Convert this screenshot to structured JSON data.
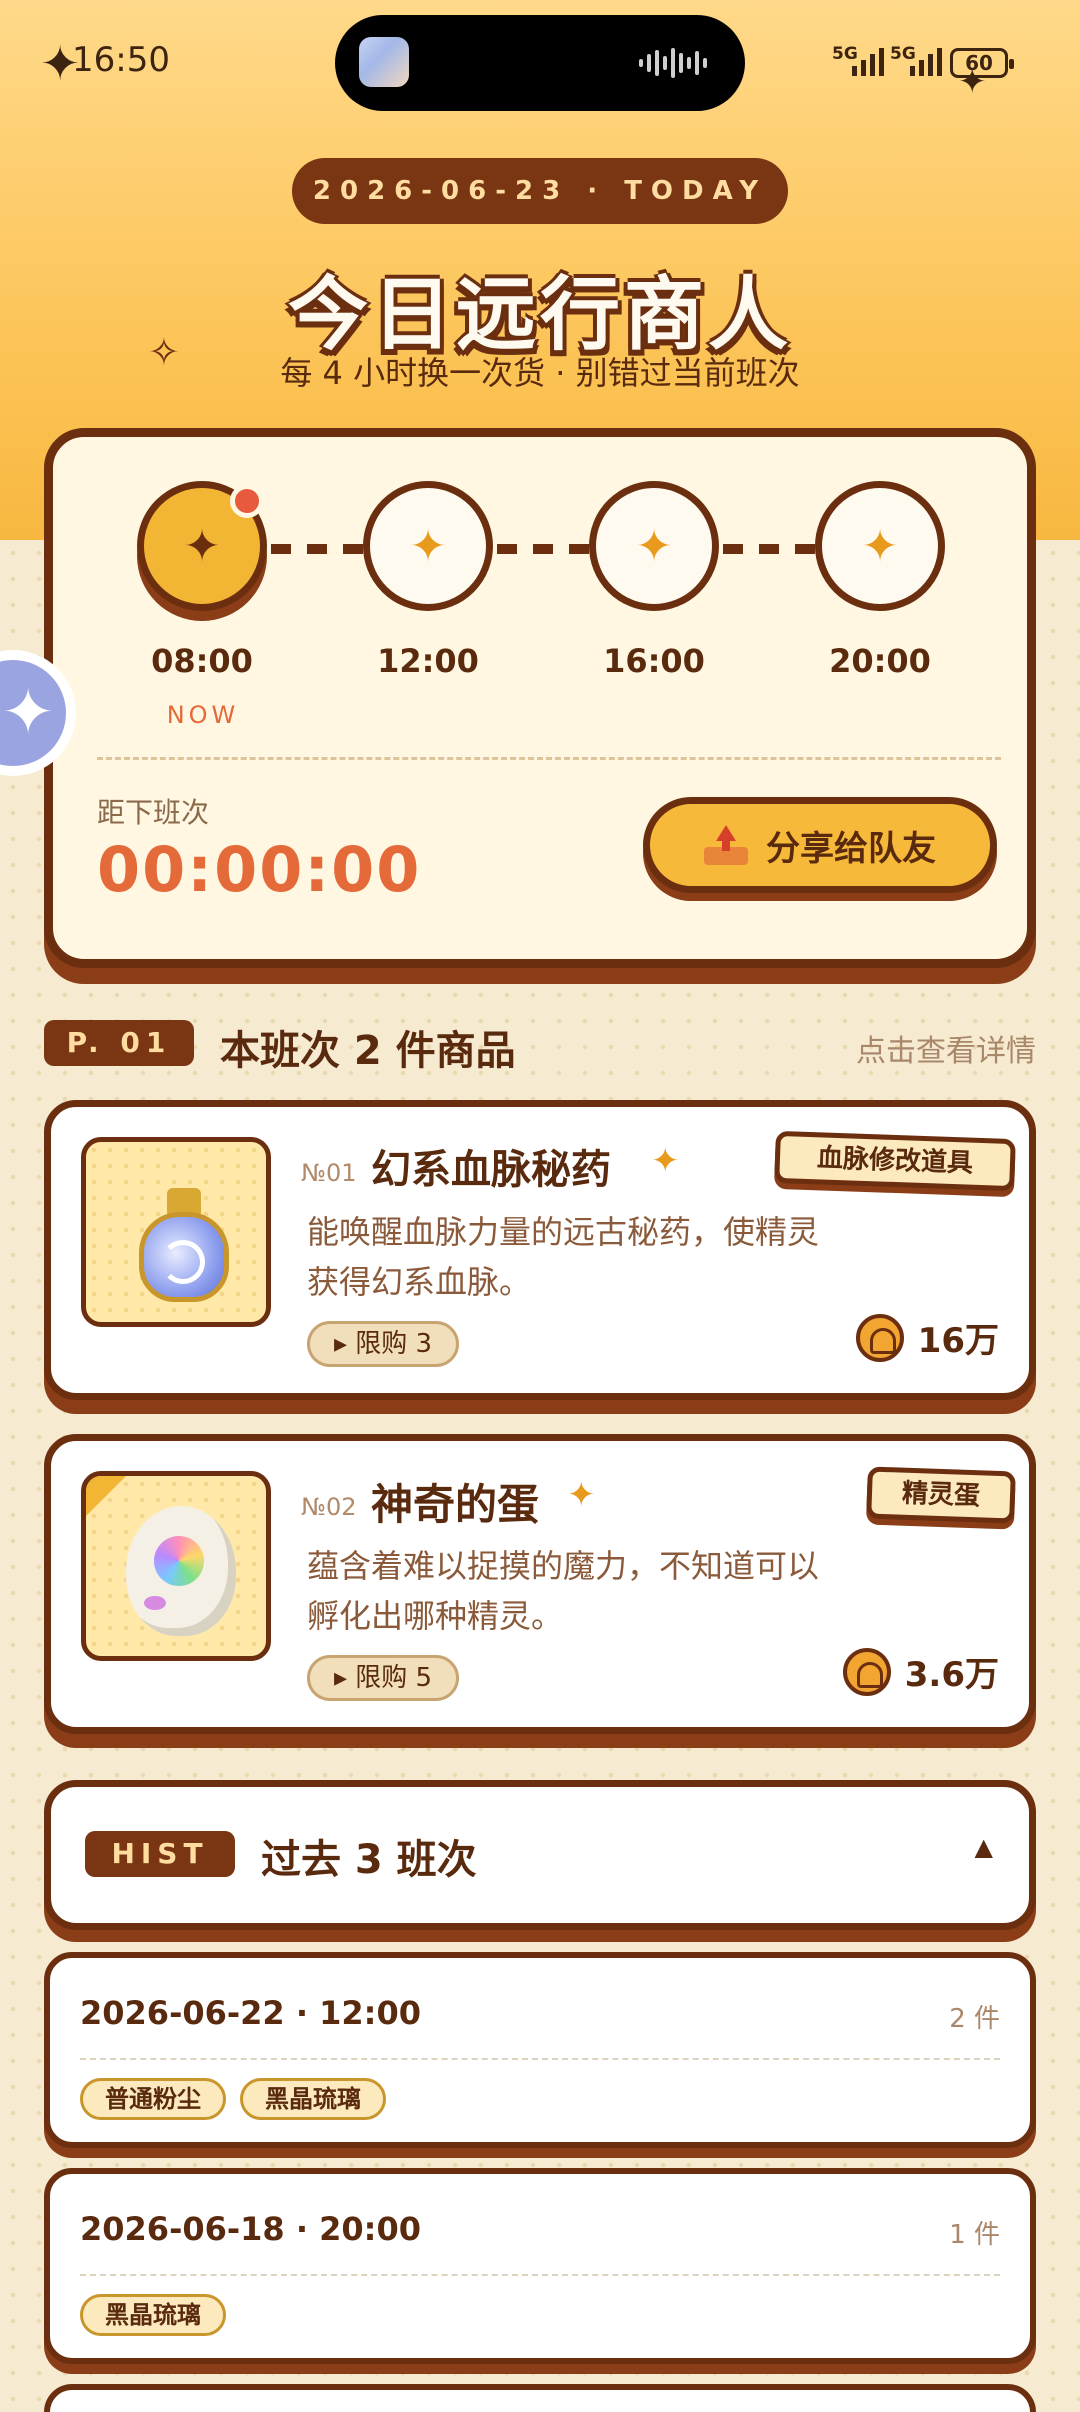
{
  "status_bar": {
    "time": "16:50",
    "signal_1": "5G",
    "signal_2": "5G",
    "battery": "60"
  },
  "header": {
    "date_pill": "2026-06-23 · TODAY",
    "title": "今日远行商人",
    "subtitle": "每 4 小时换一次货 · 别错过当前班次"
  },
  "schedule": {
    "slots": [
      {
        "time": "08:00",
        "state": "now"
      },
      {
        "time": "12:00",
        "state": "upcoming"
      },
      {
        "time": "16:00",
        "state": "upcoming"
      },
      {
        "time": "20:00",
        "state": "upcoming"
      }
    ],
    "now_label": "NOW",
    "next_label": "距下班次",
    "countdown": "00:00:00",
    "share_label": "分享给队友"
  },
  "section": {
    "page_pill": "P. 01",
    "title": "本班次 2 件商品",
    "link": "点击查看详情"
  },
  "items": [
    {
      "no": "№01",
      "name": "幻系血脉秘药",
      "category": "血脉修改道具",
      "desc_line1": "能唤醒血脉力量的远古秘药，使精灵",
      "desc_line2": "获得幻系血脉。",
      "limit": "▸ 限购 3",
      "price": "16万"
    },
    {
      "no": "№02",
      "name": "神奇的蛋",
      "category": "精灵蛋",
      "desc_line1": "蕴含着难以捉摸的魔力，不知道可以",
      "desc_line2": "孵化出哪种精灵。",
      "limit": "▸ 限购 5",
      "price": "3.6万"
    }
  ],
  "history": {
    "pill": "HIST",
    "title": "过去 3 班次",
    "toggle": "▲",
    "rows": [
      {
        "date": "2026-06-22 · 12:00",
        "count": "2 件",
        "chips": [
          "普通粉尘",
          "黑晶琉璃"
        ]
      },
      {
        "date": "2026-06-18 · 20:00",
        "count": "1 件",
        "chips": [
          "黑晶琉璃"
        ]
      }
    ]
  },
  "colors": {
    "accent": "#f2b534",
    "border": "#6b2f10",
    "countdown": "#e56a3a",
    "background": "#f6ead0"
  }
}
